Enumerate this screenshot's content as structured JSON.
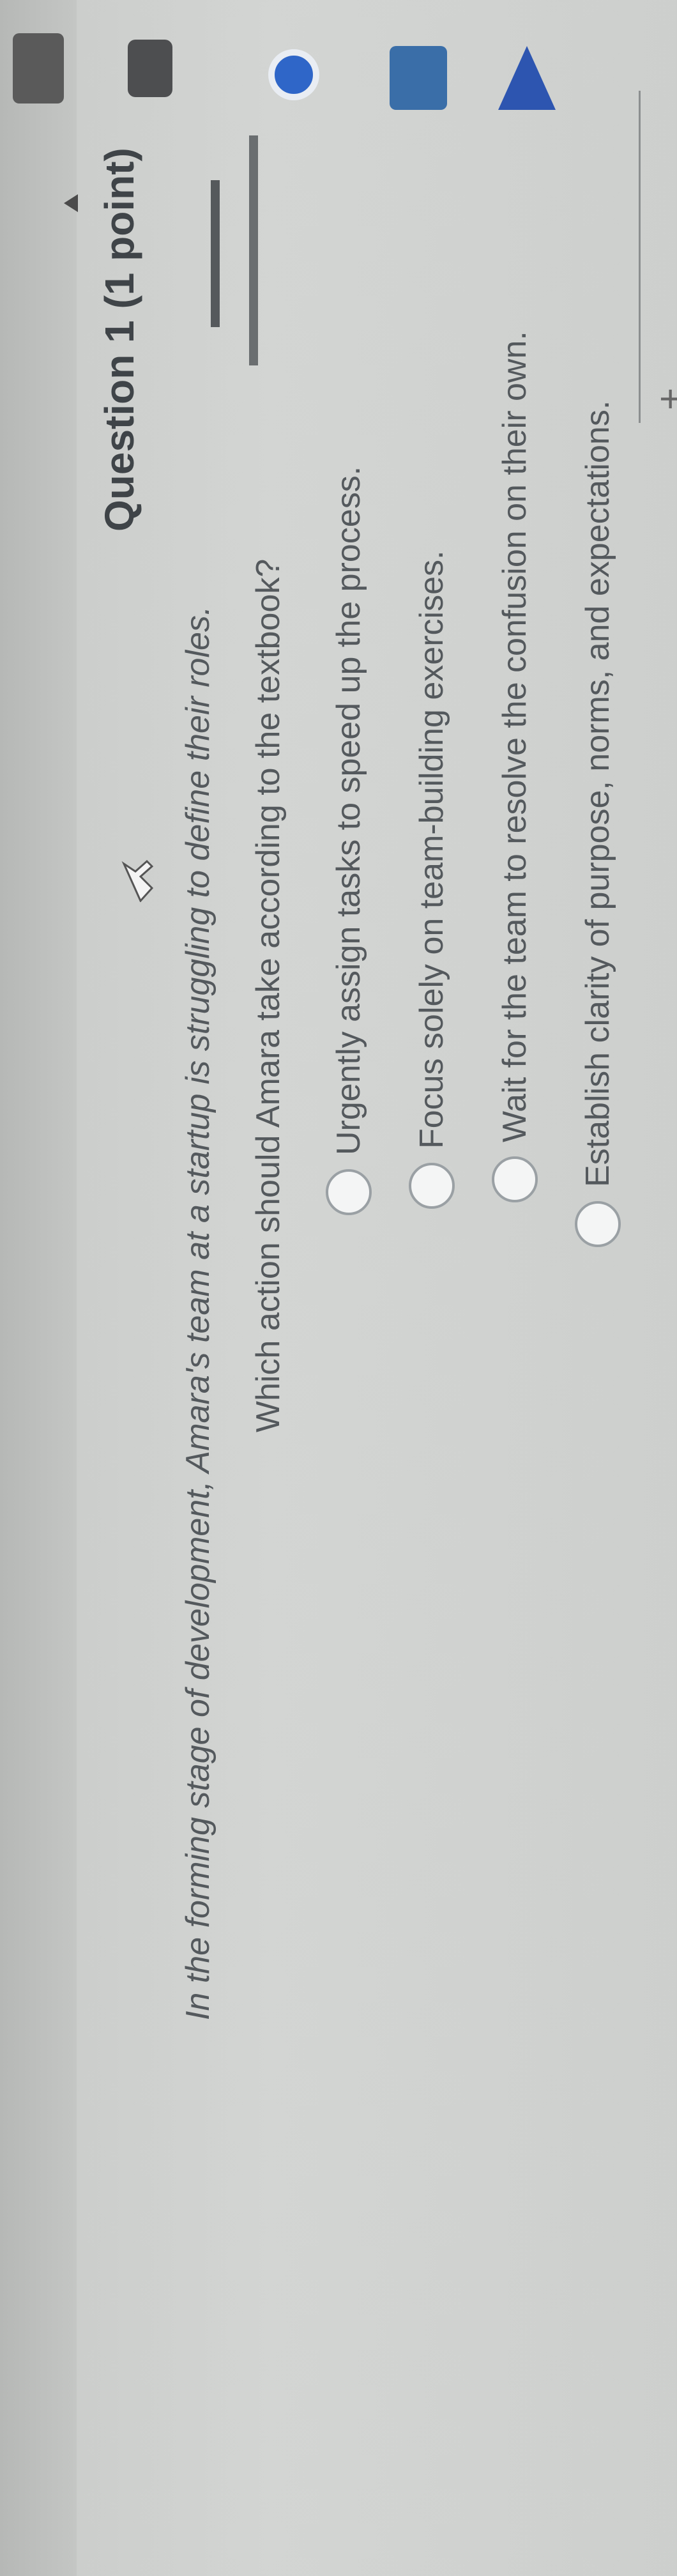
{
  "question": {
    "title": "Question 1 (1 point)",
    "text_line1": "In the forming stage of development, Amara's team at a startup is struggling to define their roles.",
    "text_line2": "Which action should Amara take according to the textbook?"
  },
  "options": [
    {
      "label": "Urgently assign tasks to speed up the process."
    },
    {
      "label": "Focus solely on team-building exercises."
    },
    {
      "label": "Wait for the team to resolve the confusion on their own."
    },
    {
      "label": "Establish clarity of purpose, norms, and expectations."
    }
  ],
  "colors": {
    "background": "#cfd1cf",
    "text": "#54595d",
    "accent_bar": "#55595c"
  },
  "icons": [
    "cursor-icon",
    "plus-icon",
    "radio-button-icon",
    "taskbar-icon"
  ]
}
